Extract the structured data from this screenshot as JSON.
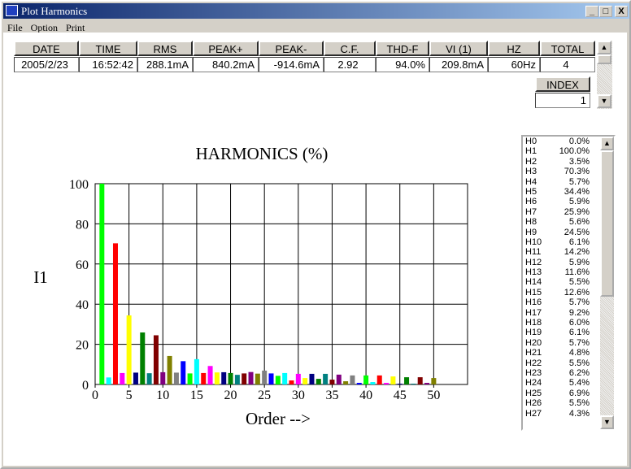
{
  "window": {
    "title": "Plot Harmonics",
    "minimize": "_",
    "maximize": "□",
    "close": "X"
  },
  "menu": [
    "File",
    "Option",
    "Print"
  ],
  "summary": {
    "headers": [
      "DATE",
      "TIME",
      "RMS",
      "PEAK+",
      "PEAK-",
      "C.F.",
      "THD-F",
      "VI (1)",
      "HZ",
      "TOTAL"
    ],
    "values": [
      "2005/2/23",
      "16:52:42",
      "288.1mA",
      "840.2mA",
      "-914.6mA",
      "2.92",
      "94.0%",
      "209.8mA",
      "60Hz",
      "4"
    ],
    "index_label": "INDEX",
    "index_value": "1"
  },
  "list": [
    [
      "H0",
      "0.0%"
    ],
    [
      "H1",
      "100.0%"
    ],
    [
      "H2",
      "3.5%"
    ],
    [
      "H3",
      "70.3%"
    ],
    [
      "H4",
      "5.7%"
    ],
    [
      "H5",
      "34.4%"
    ],
    [
      "H6",
      "5.9%"
    ],
    [
      "H7",
      "25.9%"
    ],
    [
      "H8",
      "5.6%"
    ],
    [
      "H9",
      "24.5%"
    ],
    [
      "H10",
      "6.1%"
    ],
    [
      "H11",
      "14.2%"
    ],
    [
      "H12",
      "5.9%"
    ],
    [
      "H13",
      "11.6%"
    ],
    [
      "H14",
      "5.5%"
    ],
    [
      "H15",
      "12.6%"
    ],
    [
      "H16",
      "5.7%"
    ],
    [
      "H17",
      "9.2%"
    ],
    [
      "H18",
      "6.0%"
    ],
    [
      "H19",
      "6.1%"
    ],
    [
      "H20",
      "5.7%"
    ],
    [
      "H21",
      "4.8%"
    ],
    [
      "H22",
      "5.5%"
    ],
    [
      "H23",
      "6.2%"
    ],
    [
      "H24",
      "5.4%"
    ],
    [
      "H25",
      "6.9%"
    ],
    [
      "H26",
      "5.5%"
    ],
    [
      "H27",
      "4.3%"
    ]
  ],
  "chart_data": {
    "type": "bar",
    "title": "HARMONICS (%)",
    "xlabel": "Order -->",
    "ylabel": "I1",
    "xlim": [
      0,
      55
    ],
    "ylim": [
      0,
      100
    ],
    "grid": true,
    "xticks": [
      0,
      5,
      10,
      15,
      20,
      25,
      30,
      35,
      40,
      45,
      50
    ],
    "yticks": [
      0,
      20,
      40,
      60,
      80,
      100
    ],
    "x": [
      1,
      2,
      3,
      4,
      5,
      6,
      7,
      8,
      9,
      10,
      11,
      12,
      13,
      14,
      15,
      16,
      17,
      18,
      19,
      20,
      21,
      22,
      23,
      24,
      25,
      26,
      27,
      28,
      29,
      30,
      31,
      32,
      33,
      34,
      35,
      36,
      37,
      38,
      39,
      40,
      41,
      42,
      43,
      44,
      45,
      46,
      47,
      48,
      49,
      50
    ],
    "values": [
      100,
      3.5,
      70.3,
      5.7,
      34.4,
      5.9,
      25.9,
      5.6,
      24.5,
      6.1,
      14.2,
      5.9,
      11.6,
      5.5,
      12.6,
      5.7,
      9.2,
      6.0,
      6.1,
      5.7,
      4.8,
      5.5,
      6.2,
      5.4,
      6.9,
      5.5,
      4.3,
      5.7,
      2.0,
      5.3,
      3.2,
      5.3,
      2.8,
      5.3,
      2.4,
      4.9,
      1.6,
      4.5,
      0.8,
      4.5,
      1.2,
      4.5,
      0.8,
      4.0,
      0.4,
      3.6,
      0.4,
      3.6,
      0.8,
      3.2
    ],
    "colors": [
      "#00ff00",
      "#00ffff",
      "#ff0000",
      "#ff00ff",
      "#ffff00",
      "#000080",
      "#008000",
      "#008080",
      "#800000",
      "#800080",
      "#808000",
      "#808080",
      "#0000ff"
    ]
  }
}
